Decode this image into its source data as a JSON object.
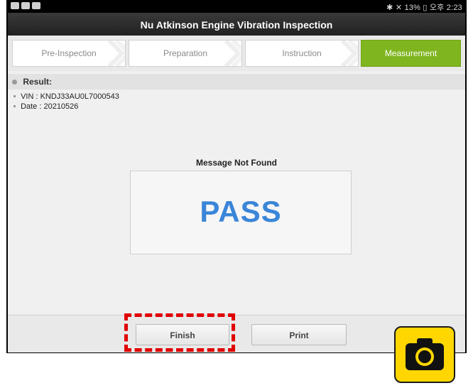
{
  "status_bar": {
    "right_text": "✱ ✕ 13% ▯ 오후 2:23"
  },
  "window": {
    "title": "Nu Atkinson Engine Vibration Inspection"
  },
  "steps": [
    {
      "label": "Pre-Inspection",
      "active": false
    },
    {
      "label": "Preparation",
      "active": false
    },
    {
      "label": "Instruction",
      "active": false
    },
    {
      "label": "Measurement",
      "active": true
    }
  ],
  "result": {
    "header": "Result:",
    "vin": "VIN : KNDJ33AU0L7000543",
    "date": "Date : 20210526"
  },
  "message": {
    "title": "Message Not Found",
    "verdict": "PASS"
  },
  "buttons": {
    "finish": "Finish",
    "print": "Print"
  },
  "colors": {
    "accent_green": "#7fb51f",
    "pass_blue": "#3a86d8",
    "highlight_red": "#e00000",
    "camera_yellow": "#ffd600"
  },
  "icons": [
    "app-icon",
    "camera-icon"
  ]
}
